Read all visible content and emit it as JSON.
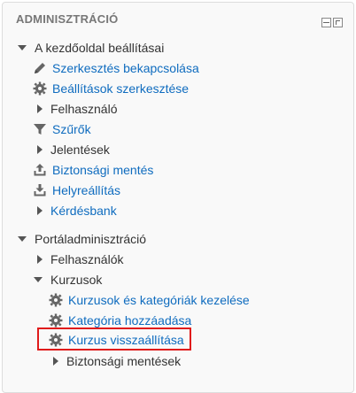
{
  "block": {
    "title": "ADMINISZTRÁCIÓ"
  },
  "tree": {
    "front_page": {
      "label": "A kezdőoldal beállításai",
      "items": {
        "edit_on": "Szerkesztés bekapcsolása",
        "edit_settings": "Beállítások szerkesztése",
        "user": "Felhasználó",
        "filters": "Szűrők",
        "reports": "Jelentések",
        "backup": "Biztonsági mentés",
        "restore": "Helyreállítás",
        "question_bank": "Kérdésbank"
      }
    },
    "site_admin": {
      "label": "Portáladminisztráció",
      "users": "Felhasználók",
      "courses": {
        "label": "Kurzusok",
        "manage": "Kurzusok és kategóriák kezelése",
        "add_category": "Kategória hozzáadása",
        "restore_course": "Kurzus visszaállítása",
        "backups": "Biztonsági mentések"
      }
    }
  },
  "colors": {
    "link": "#0f6cbf",
    "highlight_border": "#e01b1b"
  }
}
